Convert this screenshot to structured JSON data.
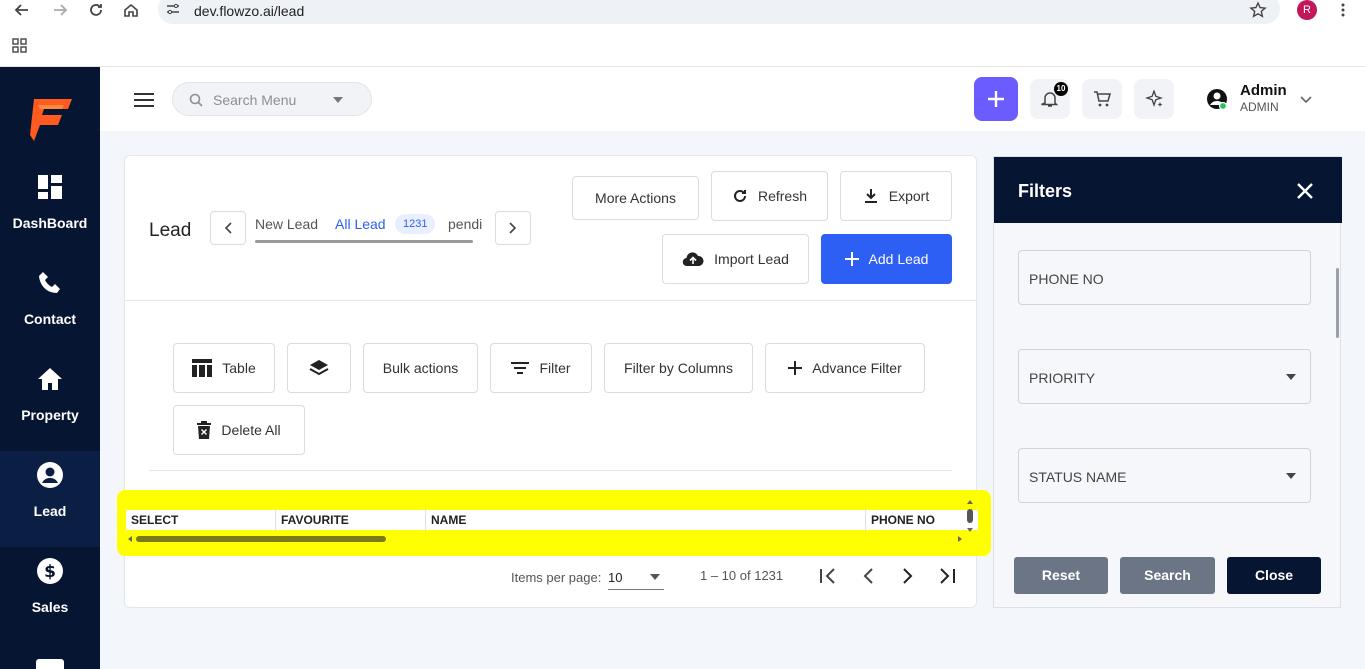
{
  "browser": {
    "url": "dev.flowzo.ai/lead",
    "profile_initial": "R"
  },
  "sidebar": {
    "items": [
      {
        "label": "DashBoard",
        "icon": "dashboard-icon"
      },
      {
        "label": "Contact",
        "icon": "phone-icon"
      },
      {
        "label": "Property",
        "icon": "home-icon"
      },
      {
        "label": "Lead",
        "icon": "user-circle-icon"
      },
      {
        "label": "Sales",
        "icon": "dollar-icon"
      }
    ],
    "active": "Lead"
  },
  "topbar": {
    "search_placeholder": "Search Menu",
    "notification_count": "10",
    "user_name": "Admin",
    "user_role": "ADMIN"
  },
  "lead": {
    "title": "Lead",
    "tabs": [
      {
        "label": "New Lead"
      },
      {
        "label": "All Lead",
        "count": "1231"
      },
      {
        "label": "pendi"
      }
    ],
    "actions": {
      "more_actions": "More Actions",
      "refresh": "Refresh",
      "export": "Export",
      "import": "Import Lead",
      "add": "Add Lead"
    },
    "toolbar": {
      "table": "Table",
      "bulk_actions": "Bulk actions",
      "filter": "Filter",
      "filter_by_columns": "Filter by Columns",
      "advance_filter": "Advance Filter",
      "delete_all": "Delete All"
    },
    "columns": [
      "SELECT",
      "FAVOURITE",
      "NAME",
      "PHONE NO"
    ],
    "pagination": {
      "items_per_page_label": "Items per page:",
      "items_per_page": "10",
      "range": "1 – 10 of 1231"
    }
  },
  "filters": {
    "title": "Filters",
    "fields": [
      "PHONE NO",
      "PRIORITY",
      "STATUS NAME"
    ],
    "reset": "Reset",
    "search": "Search",
    "close": "Close"
  },
  "colors": {
    "sidebar_bg": "#061532",
    "primary": "#2d5ff5",
    "accent_purple": "#6a5cff",
    "highlight": "#ffff00"
  }
}
